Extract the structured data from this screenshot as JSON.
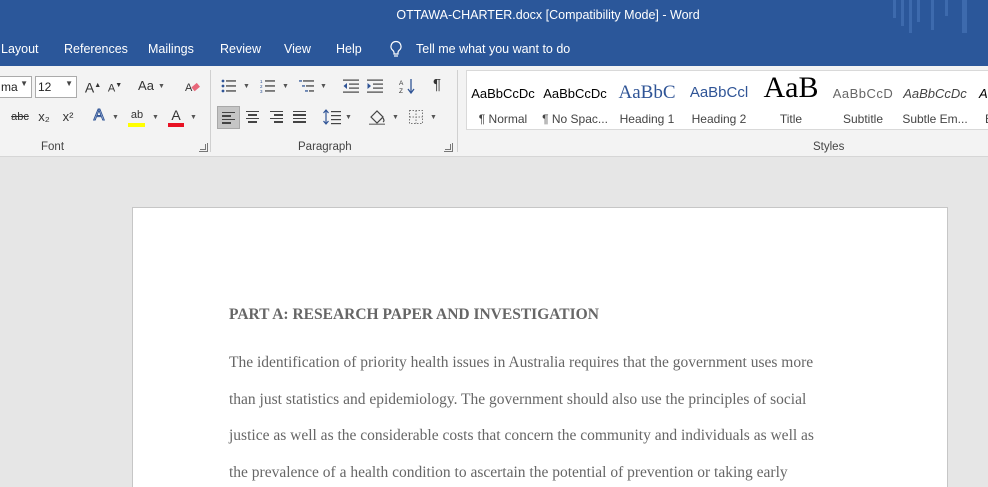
{
  "window": {
    "title": "OTTAWA-CHARTER.docx [Compatibility Mode]  -  Word"
  },
  "menu": {
    "tabs": [
      "Layout",
      "References",
      "Mailings",
      "Review",
      "View",
      "Help"
    ],
    "tell_me": "Tell me what you want to do"
  },
  "ribbon": {
    "font": {
      "name": "ma",
      "size": "12",
      "group_label": "Font",
      "grow_label": "A",
      "shrink_label": "A",
      "case_label": "Aa",
      "strike_label": "abc",
      "sub_label": "x₂",
      "super_label": "x²",
      "effects_label": "A",
      "highlight_label": "ab",
      "color_label": "A"
    },
    "paragraph": {
      "group_label": "Paragraph"
    },
    "styles": {
      "group_label": "Styles",
      "items": [
        {
          "sample": "AaBbCcDc",
          "name": "¶ Normal"
        },
        {
          "sample": "AaBbCcDc",
          "name": "¶ No Spac..."
        },
        {
          "sample": "AaBbC",
          "name": "Heading 1"
        },
        {
          "sample": "AaBbCcl",
          "name": "Heading 2"
        },
        {
          "sample": "AaB",
          "name": "Title"
        },
        {
          "sample": "AaBbCcD",
          "name": "Subtitle"
        },
        {
          "sample": "AaBbCcDc",
          "name": "Subtle Em..."
        },
        {
          "sample": "A",
          "name": "E"
        }
      ]
    },
    "accent_colors": {
      "highlight": "#ffff00",
      "font_color": "#e81123",
      "heading": "#2f5496"
    }
  },
  "document": {
    "heading": "PART A: RESEARCH PAPER AND INVESTIGATION",
    "lines": [
      "The identification of priority health issues in Australia requires that the government uses more",
      "than just statistics and epidemiology. The government should also use the principles of social",
      "justice as well as the considerable costs that concern the community and individuals as well as",
      "the prevalence of a health condition to ascertain the potential of prevention or taking early"
    ]
  }
}
